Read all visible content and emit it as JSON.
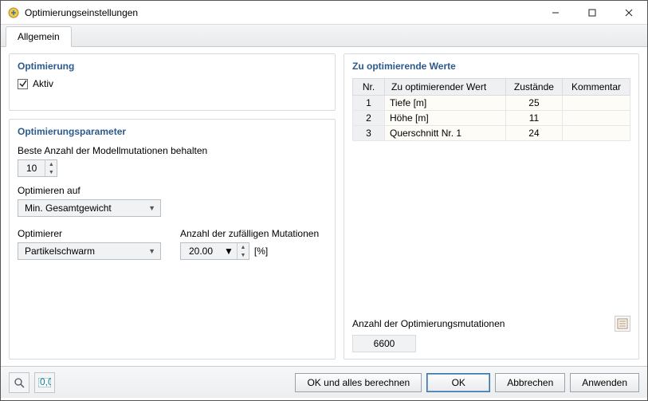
{
  "window": {
    "title": "Optimierungseinstellungen"
  },
  "tabs": {
    "general": "Allgemein"
  },
  "optimization": {
    "title": "Optimierung",
    "active_label": "Aktiv",
    "active_checked": true
  },
  "params": {
    "title": "Optimierungsparameter",
    "keep_best_label": "Beste Anzahl der Modellmutationen behalten",
    "keep_best_value": "10",
    "optimize_on_label": "Optimieren auf",
    "optimize_on_value": "Min. Gesamtgewicht",
    "optimizer_label": "Optimierer",
    "optimizer_value": "Partikelschwarm",
    "rand_mut_label": "Anzahl der zufälligen Mutationen",
    "rand_mut_value": "20.00",
    "rand_mut_unit": "[%]"
  },
  "values": {
    "title": "Zu optimierende Werte",
    "headers": {
      "nr": "Nr.",
      "name": "Zu optimierender Wert",
      "states": "Zustände",
      "comment": "Kommentar"
    },
    "rows": [
      {
        "nr": "1",
        "name": "Tiefe [m]",
        "states": "25",
        "comment": ""
      },
      {
        "nr": "2",
        "name": "Höhe [m]",
        "states": "11",
        "comment": ""
      },
      {
        "nr": "3",
        "name": "Querschnitt Nr. 1",
        "states": "24",
        "comment": ""
      }
    ],
    "mut_count_label": "Anzahl der Optimierungsmutationen",
    "mut_count_value": "6600"
  },
  "buttons": {
    "ok_calc": "OK und alles berechnen",
    "ok": "OK",
    "cancel": "Abbrechen",
    "apply": "Anwenden"
  }
}
